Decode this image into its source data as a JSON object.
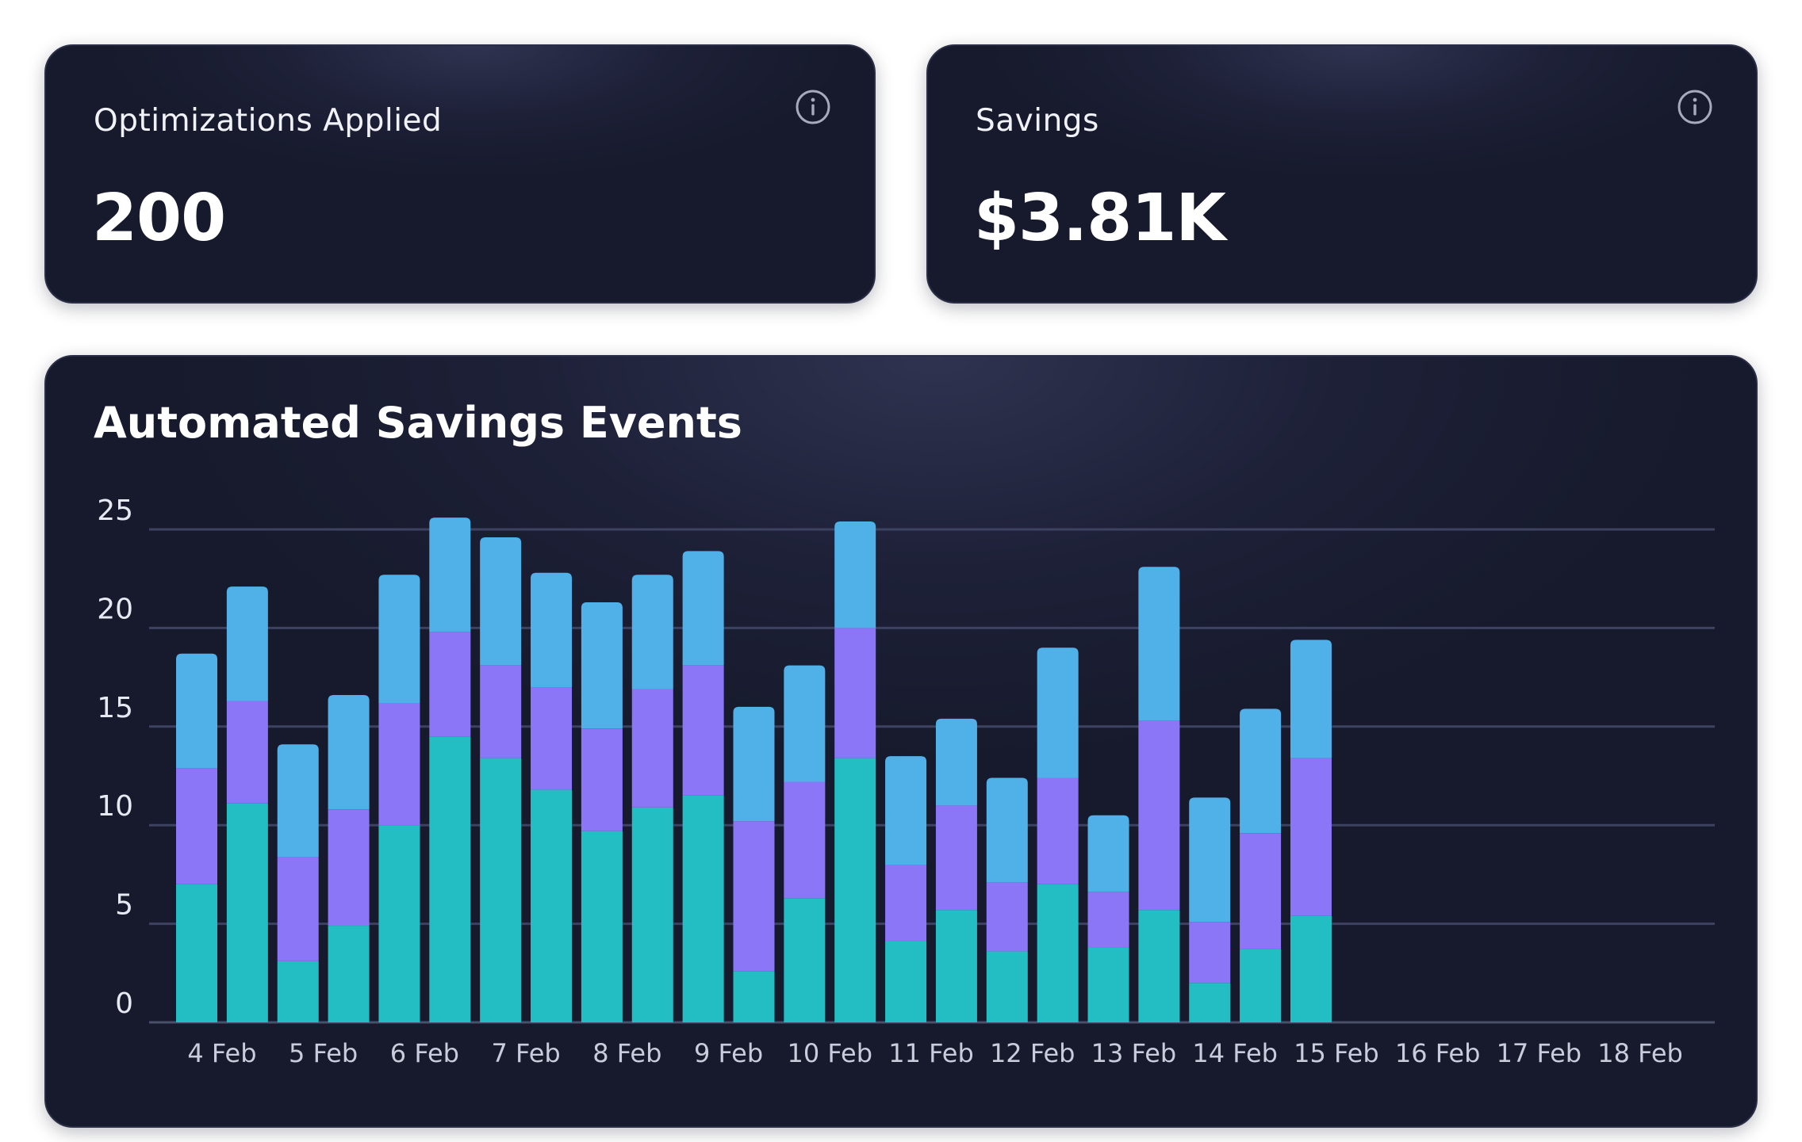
{
  "kpis": {
    "optimizations": {
      "label": "Optimizations Applied",
      "value": "200",
      "icon": "info-icon"
    },
    "savings": {
      "label": "Savings",
      "value": "$3.81K",
      "icon": "info-icon"
    }
  },
  "colors": {
    "series_bottom": "#22bec4",
    "series_middle": "#8a76f6",
    "series_top": "#50b0e8",
    "card_background": "#1b1e33"
  },
  "chart_data": {
    "type": "bar",
    "stacked": true,
    "title": "Automated Savings Events",
    "xlabel": "",
    "ylabel": "",
    "ylim": [
      0,
      25
    ],
    "yticks": [
      0,
      5,
      10,
      15,
      20,
      25
    ],
    "grid": true,
    "categories": [
      "4 Feb",
      "",
      "5 Feb",
      "",
      "6 Feb",
      "",
      "7 Feb",
      "",
      "8 Feb",
      "",
      "9 Feb",
      "",
      "10 Feb",
      "",
      "11 Feb",
      "",
      "12 Feb",
      "",
      "13 Feb",
      "",
      "14 Feb",
      "",
      "15 Feb",
      "",
      "16 Feb",
      "",
      "17 Feb",
      "",
      "18 Feb",
      ""
    ],
    "xtick_labels": [
      "4 Feb",
      "5 Feb",
      "6 Feb",
      "7 Feb",
      "8 Feb",
      "9 Feb",
      "10 Feb",
      "11 Feb",
      "12 Feb",
      "13 Feb",
      "14 Feb",
      "15 Feb",
      "16 Feb",
      "17 Feb",
      "18 Feb"
    ],
    "series": [
      {
        "color": "#22bec4",
        "values": [
          7.0,
          11.1,
          3.1,
          4.9,
          10.0,
          14.5,
          13.4,
          11.8,
          9.7,
          10.9,
          11.5,
          2.6,
          6.3,
          13.4,
          4.1,
          5.7,
          3.6,
          7.0,
          3.8,
          5.7,
          2.0,
          3.7,
          5.4
        ]
      },
      {
        "color": "#8a76f6",
        "values": [
          5.9,
          5.2,
          5.3,
          5.9,
          6.2,
          5.3,
          4.7,
          5.2,
          5.2,
          6.0,
          6.6,
          7.6,
          5.9,
          6.6,
          3.9,
          5.3,
          3.5,
          5.4,
          2.8,
          9.6,
          3.1,
          5.9,
          8.0
        ]
      },
      {
        "color": "#50b0e8",
        "values": [
          5.8,
          5.8,
          5.7,
          5.8,
          6.5,
          5.8,
          6.5,
          5.8,
          6.4,
          5.8,
          5.8,
          5.8,
          5.9,
          5.4,
          5.5,
          4.4,
          5.3,
          6.6,
          3.9,
          7.8,
          6.3,
          6.3,
          6.0
        ]
      }
    ]
  }
}
